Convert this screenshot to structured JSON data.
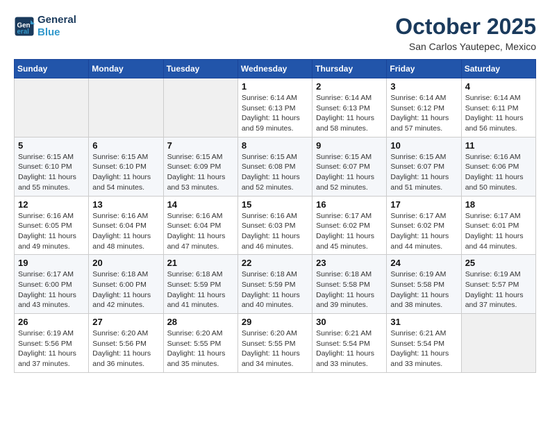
{
  "header": {
    "logo_line1": "General",
    "logo_line2": "Blue",
    "month": "October 2025",
    "location": "San Carlos Yautepec, Mexico"
  },
  "weekdays": [
    "Sunday",
    "Monday",
    "Tuesday",
    "Wednesday",
    "Thursday",
    "Friday",
    "Saturday"
  ],
  "weeks": [
    [
      {
        "day": "",
        "info": ""
      },
      {
        "day": "",
        "info": ""
      },
      {
        "day": "",
        "info": ""
      },
      {
        "day": "1",
        "info": "Sunrise: 6:14 AM\nSunset: 6:13 PM\nDaylight: 11 hours\nand 59 minutes."
      },
      {
        "day": "2",
        "info": "Sunrise: 6:14 AM\nSunset: 6:13 PM\nDaylight: 11 hours\nand 58 minutes."
      },
      {
        "day": "3",
        "info": "Sunrise: 6:14 AM\nSunset: 6:12 PM\nDaylight: 11 hours\nand 57 minutes."
      },
      {
        "day": "4",
        "info": "Sunrise: 6:14 AM\nSunset: 6:11 PM\nDaylight: 11 hours\nand 56 minutes."
      }
    ],
    [
      {
        "day": "5",
        "info": "Sunrise: 6:15 AM\nSunset: 6:10 PM\nDaylight: 11 hours\nand 55 minutes."
      },
      {
        "day": "6",
        "info": "Sunrise: 6:15 AM\nSunset: 6:10 PM\nDaylight: 11 hours\nand 54 minutes."
      },
      {
        "day": "7",
        "info": "Sunrise: 6:15 AM\nSunset: 6:09 PM\nDaylight: 11 hours\nand 53 minutes."
      },
      {
        "day": "8",
        "info": "Sunrise: 6:15 AM\nSunset: 6:08 PM\nDaylight: 11 hours\nand 52 minutes."
      },
      {
        "day": "9",
        "info": "Sunrise: 6:15 AM\nSunset: 6:07 PM\nDaylight: 11 hours\nand 52 minutes."
      },
      {
        "day": "10",
        "info": "Sunrise: 6:15 AM\nSunset: 6:07 PM\nDaylight: 11 hours\nand 51 minutes."
      },
      {
        "day": "11",
        "info": "Sunrise: 6:16 AM\nSunset: 6:06 PM\nDaylight: 11 hours\nand 50 minutes."
      }
    ],
    [
      {
        "day": "12",
        "info": "Sunrise: 6:16 AM\nSunset: 6:05 PM\nDaylight: 11 hours\nand 49 minutes."
      },
      {
        "day": "13",
        "info": "Sunrise: 6:16 AM\nSunset: 6:04 PM\nDaylight: 11 hours\nand 48 minutes."
      },
      {
        "day": "14",
        "info": "Sunrise: 6:16 AM\nSunset: 6:04 PM\nDaylight: 11 hours\nand 47 minutes."
      },
      {
        "day": "15",
        "info": "Sunrise: 6:16 AM\nSunset: 6:03 PM\nDaylight: 11 hours\nand 46 minutes."
      },
      {
        "day": "16",
        "info": "Sunrise: 6:17 AM\nSunset: 6:02 PM\nDaylight: 11 hours\nand 45 minutes."
      },
      {
        "day": "17",
        "info": "Sunrise: 6:17 AM\nSunset: 6:02 PM\nDaylight: 11 hours\nand 44 minutes."
      },
      {
        "day": "18",
        "info": "Sunrise: 6:17 AM\nSunset: 6:01 PM\nDaylight: 11 hours\nand 44 minutes."
      }
    ],
    [
      {
        "day": "19",
        "info": "Sunrise: 6:17 AM\nSunset: 6:00 PM\nDaylight: 11 hours\nand 43 minutes."
      },
      {
        "day": "20",
        "info": "Sunrise: 6:18 AM\nSunset: 6:00 PM\nDaylight: 11 hours\nand 42 minutes."
      },
      {
        "day": "21",
        "info": "Sunrise: 6:18 AM\nSunset: 5:59 PM\nDaylight: 11 hours\nand 41 minutes."
      },
      {
        "day": "22",
        "info": "Sunrise: 6:18 AM\nSunset: 5:59 PM\nDaylight: 11 hours\nand 40 minutes."
      },
      {
        "day": "23",
        "info": "Sunrise: 6:18 AM\nSunset: 5:58 PM\nDaylight: 11 hours\nand 39 minutes."
      },
      {
        "day": "24",
        "info": "Sunrise: 6:19 AM\nSunset: 5:58 PM\nDaylight: 11 hours\nand 38 minutes."
      },
      {
        "day": "25",
        "info": "Sunrise: 6:19 AM\nSunset: 5:57 PM\nDaylight: 11 hours\nand 37 minutes."
      }
    ],
    [
      {
        "day": "26",
        "info": "Sunrise: 6:19 AM\nSunset: 5:56 PM\nDaylight: 11 hours\nand 37 minutes."
      },
      {
        "day": "27",
        "info": "Sunrise: 6:20 AM\nSunset: 5:56 PM\nDaylight: 11 hours\nand 36 minutes."
      },
      {
        "day": "28",
        "info": "Sunrise: 6:20 AM\nSunset: 5:55 PM\nDaylight: 11 hours\nand 35 minutes."
      },
      {
        "day": "29",
        "info": "Sunrise: 6:20 AM\nSunset: 5:55 PM\nDaylight: 11 hours\nand 34 minutes."
      },
      {
        "day": "30",
        "info": "Sunrise: 6:21 AM\nSunset: 5:54 PM\nDaylight: 11 hours\nand 33 minutes."
      },
      {
        "day": "31",
        "info": "Sunrise: 6:21 AM\nSunset: 5:54 PM\nDaylight: 11 hours\nand 33 minutes."
      },
      {
        "day": "",
        "info": ""
      }
    ]
  ]
}
